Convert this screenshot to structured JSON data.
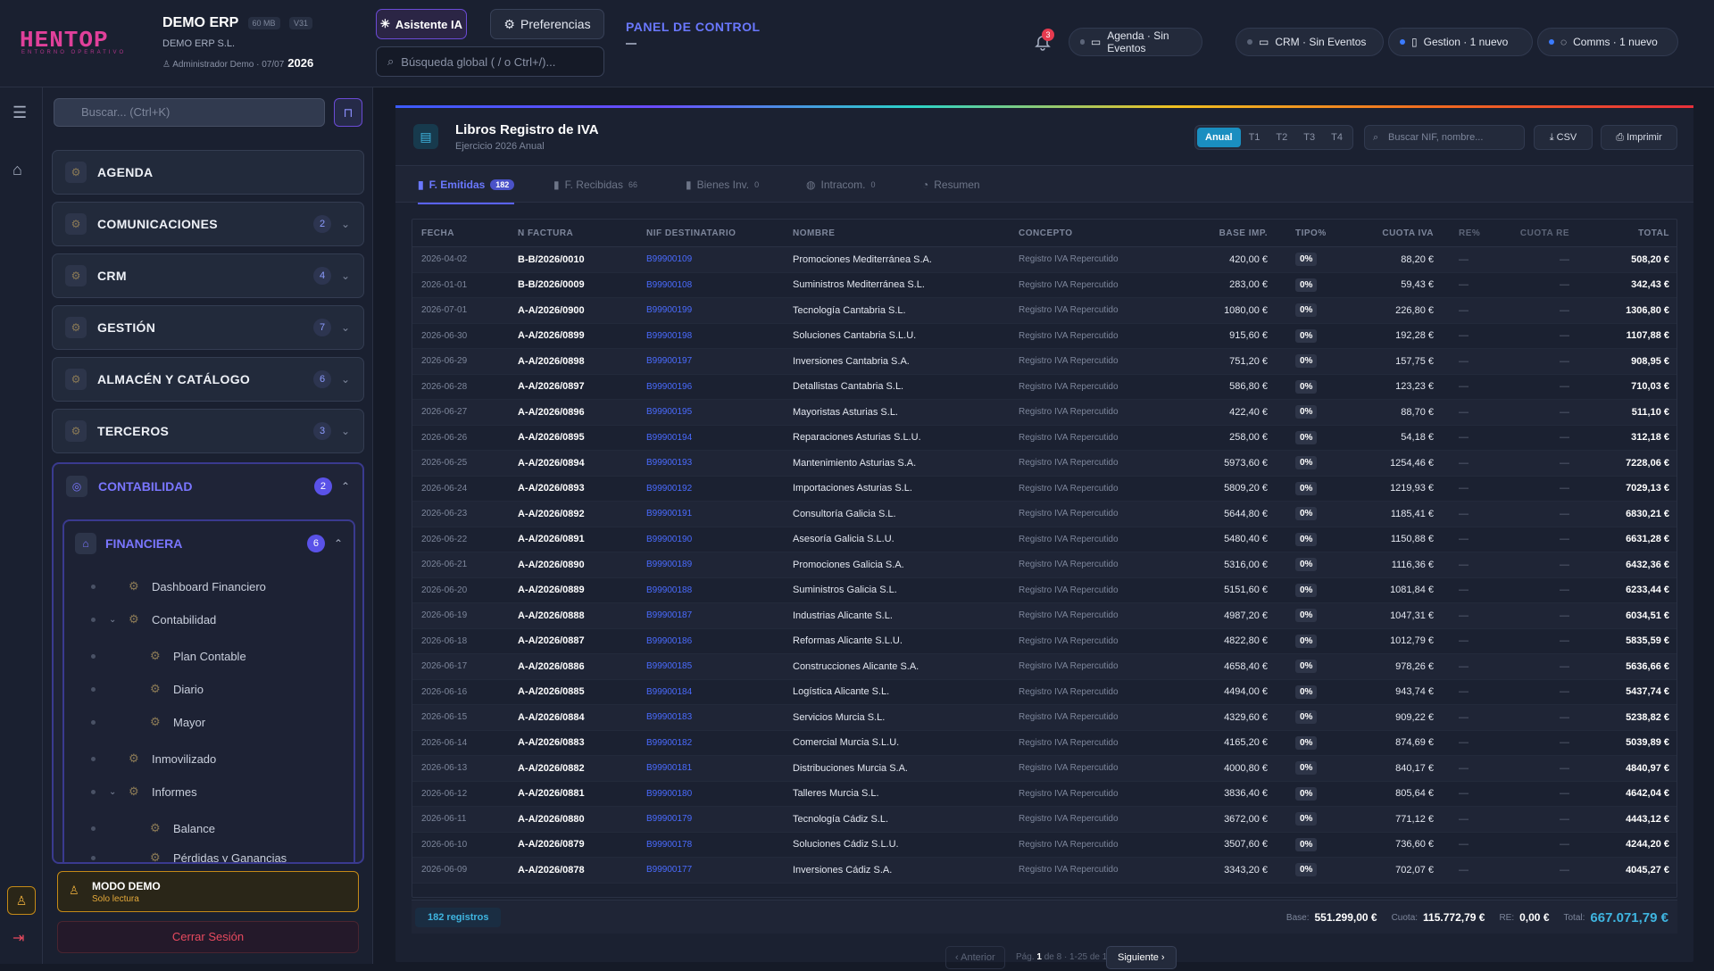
{
  "topbar": {
    "logo": "HENTOP",
    "logo_sub": "ENTORNO OPERATIVO",
    "company": "DEMO ERP",
    "chip_size": "60 MB",
    "chip_ver": "V31",
    "company_sub": "DEMO ERP S.L.",
    "user": "Administrador Demo",
    "date": "07/07",
    "year": "2026",
    "ai_button": "Asistente IA",
    "pref_button": "Preferencias",
    "search_placeholder": "Búsqueda global ( / o Ctrl+/)...",
    "panel_title": "PANEL DE CONTROL",
    "bell_count": "3",
    "chips": [
      {
        "label": "Agenda · Sin Eventos",
        "active": false
      },
      {
        "label": "CRM · Sin Eventos",
        "active": false
      },
      {
        "label": "Gestion · 1 nuevo",
        "active": true
      },
      {
        "label": "Comms · 1 nuevo",
        "active": true
      }
    ]
  },
  "sidebar": {
    "search_placeholder": "Buscar... (Ctrl+K)",
    "modules": [
      {
        "label": "AGENDA",
        "count": "",
        "chev": ""
      },
      {
        "label": "COMUNICACIONES",
        "count": "2",
        "chev": "⌄"
      },
      {
        "label": "CRM",
        "count": "4",
        "chev": "⌄"
      },
      {
        "label": "GESTIÓN",
        "count": "7",
        "chev": "⌄"
      },
      {
        "label": "ALMACÉN Y CATÁLOGO",
        "count": "6",
        "chev": "⌄"
      },
      {
        "label": "TERCEROS",
        "count": "3",
        "chev": "⌄"
      }
    ],
    "open_module": {
      "label": "CONTABILIDAD",
      "count": "2"
    },
    "sub_module": {
      "label": "FINANCIERA",
      "count": "6"
    },
    "tree": [
      "Dashboard Financiero",
      "Contabilidad",
      "Plan Contable",
      "Diario",
      "Mayor",
      "Inmovilizado",
      "Informes",
      "Balance",
      "Pérdidas y Ganancias"
    ],
    "demo_title": "MODO DEMO",
    "demo_sub": "Solo lectura",
    "logout": "Cerrar Sesión"
  },
  "main": {
    "title": "Libros Registro de IVA",
    "subtitle": "Ejercicio 2026 Anual",
    "periods": [
      "Anual",
      "T1",
      "T2",
      "T3",
      "T4"
    ],
    "search_placeholder": "Buscar NIF, nombre...",
    "csv": "CSV",
    "print": "Imprimir",
    "tabs": [
      {
        "label": "F. Emitidas",
        "badge": "182"
      },
      {
        "label": "F. Recibidas",
        "badge": "66"
      },
      {
        "label": "Bienes Inv.",
        "badge": "0"
      },
      {
        "label": "Intracom.",
        "badge": "0"
      },
      {
        "label": "Resumen",
        "badge": ""
      }
    ],
    "columns": [
      "FECHA",
      "N FACTURA",
      "NIF DESTINATARIO",
      "NOMBRE",
      "CONCEPTO",
      "BASE IMP.",
      "TIPO%",
      "CUOTA IVA",
      "RE%",
      "CUOTA RE",
      "TOTAL"
    ],
    "rows": [
      [
        "2026-04-02",
        "B-B/2026/0010",
        "B99900109",
        "Promociones Mediterránea S.A.",
        "Registro IVA Repercutido",
        "420,00 €",
        "0%",
        "88,20 €",
        "—",
        "—",
        "508,20 €"
      ],
      [
        "2026-01-01",
        "B-B/2026/0009",
        "B99900108",
        "Suministros Mediterránea S.L.",
        "Registro IVA Repercutido",
        "283,00 €",
        "0%",
        "59,43 €",
        "—",
        "—",
        "342,43 €"
      ],
      [
        "2026-07-01",
        "A-A/2026/0900",
        "B99900199",
        "Tecnología Cantabria S.L.",
        "Registro IVA Repercutido",
        "1080,00 €",
        "0%",
        "226,80 €",
        "—",
        "—",
        "1306,80 €"
      ],
      [
        "2026-06-30",
        "A-A/2026/0899",
        "B99900198",
        "Soluciones Cantabria S.L.U.",
        "Registro IVA Repercutido",
        "915,60 €",
        "0%",
        "192,28 €",
        "—",
        "—",
        "1107,88 €"
      ],
      [
        "2026-06-29",
        "A-A/2026/0898",
        "B99900197",
        "Inversiones Cantabria S.A.",
        "Registro IVA Repercutido",
        "751,20 €",
        "0%",
        "157,75 €",
        "—",
        "—",
        "908,95 €"
      ],
      [
        "2026-06-28",
        "A-A/2026/0897",
        "B99900196",
        "Detallistas Cantabria S.L.",
        "Registro IVA Repercutido",
        "586,80 €",
        "0%",
        "123,23 €",
        "—",
        "—",
        "710,03 €"
      ],
      [
        "2026-06-27",
        "A-A/2026/0896",
        "B99900195",
        "Mayoristas Asturias S.L.",
        "Registro IVA Repercutido",
        "422,40 €",
        "0%",
        "88,70 €",
        "—",
        "—",
        "511,10 €"
      ],
      [
        "2026-06-26",
        "A-A/2026/0895",
        "B99900194",
        "Reparaciones Asturias S.L.U.",
        "Registro IVA Repercutido",
        "258,00 €",
        "0%",
        "54,18 €",
        "—",
        "—",
        "312,18 €"
      ],
      [
        "2026-06-25",
        "A-A/2026/0894",
        "B99900193",
        "Mantenimiento Asturias S.A.",
        "Registro IVA Repercutido",
        "5973,60 €",
        "0%",
        "1254,46 €",
        "—",
        "—",
        "7228,06 €"
      ],
      [
        "2026-06-24",
        "A-A/2026/0893",
        "B99900192",
        "Importaciones Asturias S.L.",
        "Registro IVA Repercutido",
        "5809,20 €",
        "0%",
        "1219,93 €",
        "—",
        "—",
        "7029,13 €"
      ],
      [
        "2026-06-23",
        "A-A/2026/0892",
        "B99900191",
        "Consultoría Galicia S.L.",
        "Registro IVA Repercutido",
        "5644,80 €",
        "0%",
        "1185,41 €",
        "—",
        "—",
        "6830,21 €"
      ],
      [
        "2026-06-22",
        "A-A/2026/0891",
        "B99900190",
        "Asesoría Galicia S.L.U.",
        "Registro IVA Repercutido",
        "5480,40 €",
        "0%",
        "1150,88 €",
        "—",
        "—",
        "6631,28 €"
      ],
      [
        "2026-06-21",
        "A-A/2026/0890",
        "B99900189",
        "Promociones Galicia S.A.",
        "Registro IVA Repercutido",
        "5316,00 €",
        "0%",
        "1116,36 €",
        "—",
        "—",
        "6432,36 €"
      ],
      [
        "2026-06-20",
        "A-A/2026/0889",
        "B99900188",
        "Suministros Galicia S.L.",
        "Registro IVA Repercutido",
        "5151,60 €",
        "0%",
        "1081,84 €",
        "—",
        "—",
        "6233,44 €"
      ],
      [
        "2026-06-19",
        "A-A/2026/0888",
        "B99900187",
        "Industrias Alicante S.L.",
        "Registro IVA Repercutido",
        "4987,20 €",
        "0%",
        "1047,31 €",
        "—",
        "—",
        "6034,51 €"
      ],
      [
        "2026-06-18",
        "A-A/2026/0887",
        "B99900186",
        "Reformas Alicante S.L.U.",
        "Registro IVA Repercutido",
        "4822,80 €",
        "0%",
        "1012,79 €",
        "—",
        "—",
        "5835,59 €"
      ],
      [
        "2026-06-17",
        "A-A/2026/0886",
        "B99900185",
        "Construcciones Alicante S.A.",
        "Registro IVA Repercutido",
        "4658,40 €",
        "0%",
        "978,26 €",
        "—",
        "—",
        "5636,66 €"
      ],
      [
        "2026-06-16",
        "A-A/2026/0885",
        "B99900184",
        "Logística Alicante S.L.",
        "Registro IVA Repercutido",
        "4494,00 €",
        "0%",
        "943,74 €",
        "—",
        "—",
        "5437,74 €"
      ],
      [
        "2026-06-15",
        "A-A/2026/0884",
        "B99900183",
        "Servicios Murcia S.L.",
        "Registro IVA Repercutido",
        "4329,60 €",
        "0%",
        "909,22 €",
        "—",
        "—",
        "5238,82 €"
      ],
      [
        "2026-06-14",
        "A-A/2026/0883",
        "B99900182",
        "Comercial Murcia S.L.U.",
        "Registro IVA Repercutido",
        "4165,20 €",
        "0%",
        "874,69 €",
        "—",
        "—",
        "5039,89 €"
      ],
      [
        "2026-06-13",
        "A-A/2026/0882",
        "B99900181",
        "Distribuciones Murcia S.A.",
        "Registro IVA Repercutido",
        "4000,80 €",
        "0%",
        "840,17 €",
        "—",
        "—",
        "4840,97 €"
      ],
      [
        "2026-06-12",
        "A-A/2026/0881",
        "B99900180",
        "Talleres Murcia S.L.",
        "Registro IVA Repercutido",
        "3836,40 €",
        "0%",
        "805,64 €",
        "—",
        "—",
        "4642,04 €"
      ],
      [
        "2026-06-11",
        "A-A/2026/0880",
        "B99900179",
        "Tecnología Cádiz S.L.",
        "Registro IVA Repercutido",
        "3672,00 €",
        "0%",
        "771,12 €",
        "—",
        "—",
        "4443,12 €"
      ],
      [
        "2026-06-10",
        "A-A/2026/0879",
        "B99900178",
        "Soluciones Cádiz S.L.U.",
        "Registro IVA Repercutido",
        "3507,60 €",
        "0%",
        "736,60 €",
        "—",
        "—",
        "4244,20 €"
      ],
      [
        "2026-06-09",
        "A-A/2026/0878",
        "B99900177",
        "Inversiones Cádiz S.A.",
        "Registro IVA Repercutido",
        "3343,20 €",
        "0%",
        "702,07 €",
        "—",
        "—",
        "4045,27 €"
      ]
    ],
    "footer": {
      "records": "182 registros",
      "base_label": "Base:",
      "base": "551.299,00 €",
      "cuota_label": "Cuota:",
      "cuota": "115.772,79 €",
      "re_label": "RE:",
      "re": "0,00 €",
      "total_label": "Total:",
      "total": "667.071,79 €"
    },
    "pager": {
      "prev": "‹ Anterior",
      "page_label": "Pág.",
      "page": "1",
      "page_rest": "de 8 · 1-25 de 182",
      "next": "Siguiente ›"
    }
  }
}
